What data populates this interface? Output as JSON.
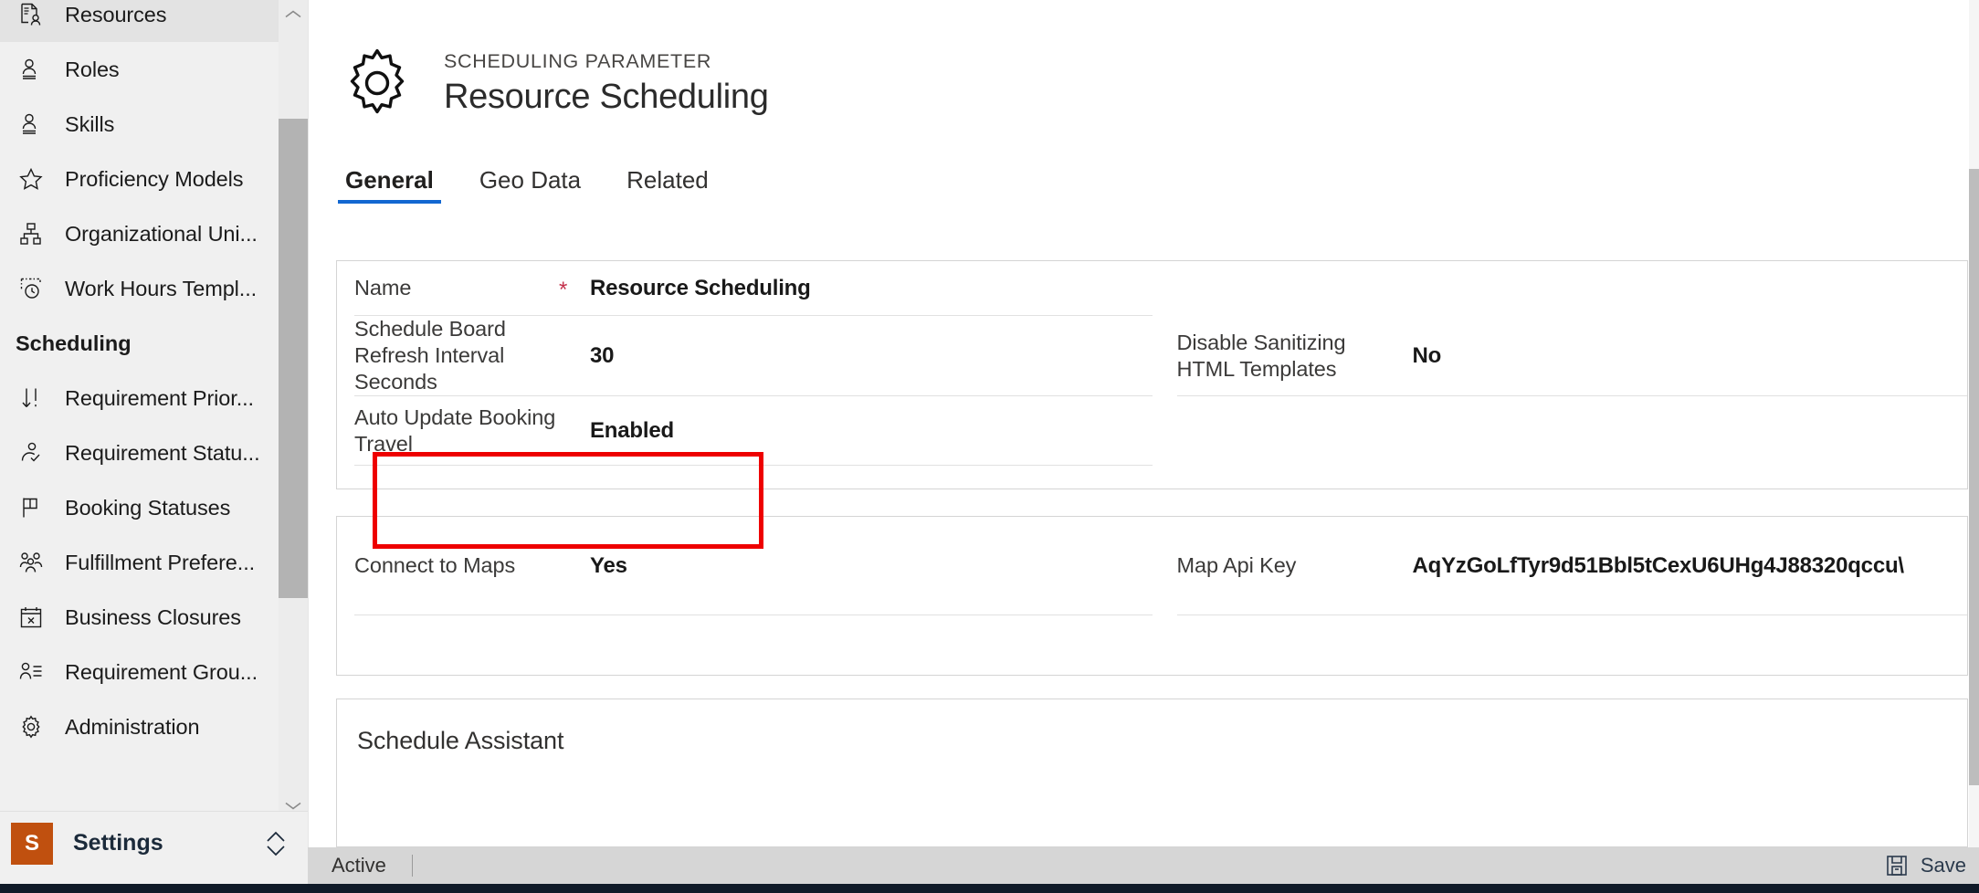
{
  "colors": {
    "accent_tab": "#1267d1",
    "annotation_red": "#ee0000",
    "settings_badge_orange": "#c0500f",
    "required_star": "#c4314b",
    "sidebar_bg": "#f0f0f0",
    "statusbar_bg": "#d6d6d6",
    "taskbar": "#101a28"
  },
  "sidebar": {
    "scroll_up_icon": "chevron-up-icon",
    "scroll_down_icon": "chevron-down-icon",
    "items": [
      {
        "label": "Resources",
        "icon": "resource-document-person-icon"
      },
      {
        "label": "Roles",
        "icon": "person-role-icon"
      },
      {
        "label": "Skills",
        "icon": "person-skill-icon"
      },
      {
        "label": "Proficiency Models",
        "icon": "star-icon"
      },
      {
        "label": "Organizational Uni...",
        "icon": "org-hierarchy-icon"
      },
      {
        "label": "Work Hours Templ...",
        "icon": "work-hours-clock-icon"
      }
    ],
    "group": {
      "header": "Scheduling",
      "items": [
        {
          "label": "Requirement Prior...",
          "icon": "sort-priority-icon"
        },
        {
          "label": "Requirement Statu...",
          "icon": "person-check-icon"
        },
        {
          "label": "Booking Statuses",
          "icon": "flag-icon"
        },
        {
          "label": "Fulfillment Prefere...",
          "icon": "people-group-icon"
        },
        {
          "label": "Business Closures",
          "icon": "calendar-x-icon"
        },
        {
          "label": "Requirement Grou...",
          "icon": "person-list-icon"
        },
        {
          "label": "Administration",
          "icon": "gear-icon"
        }
      ]
    },
    "footer": {
      "badge_letter": "S",
      "label": "Settings",
      "expand_icon": "chevron-up-down-icon"
    }
  },
  "header": {
    "entity_icon": "gear-icon",
    "entity_type": "SCHEDULING PARAMETER",
    "record_title": "Resource Scheduling"
  },
  "tabs": [
    {
      "label": "General",
      "active": true
    },
    {
      "label": "Geo Data",
      "active": false
    },
    {
      "label": "Related",
      "active": false
    }
  ],
  "cards": [
    {
      "name": "general-settings-card",
      "left_fields": [
        {
          "label": "Name",
          "required": true,
          "value": "Resource Scheduling"
        },
        {
          "label": "Schedule Board Refresh Interval Seconds",
          "required": false,
          "value": "30"
        },
        {
          "label": "Auto Update Booking Travel",
          "required": false,
          "value": "Enabled",
          "highlighted": true
        }
      ],
      "right_fields": [
        {
          "label": "Disable Sanitizing HTML Templates",
          "required": false,
          "value": "No"
        }
      ]
    },
    {
      "name": "maps-card",
      "left_fields": [
        {
          "label": "Connect to Maps",
          "required": false,
          "value": "Yes"
        }
      ],
      "right_fields": [
        {
          "label": "Map Api Key",
          "required": false,
          "value": "AqYzGoLfTyr9d51Bbl5tCexU6UHg4J88320qccu\\"
        }
      ]
    },
    {
      "name": "schedule-assistant-card",
      "section_title": "Schedule Assistant"
    }
  ],
  "annotation": {
    "target_field": "Auto Update Booking Travel",
    "border_color": "#ee0000"
  },
  "status_bar": {
    "state": "Active",
    "save_icon": "save-floppy-icon",
    "save_label": "Save"
  }
}
